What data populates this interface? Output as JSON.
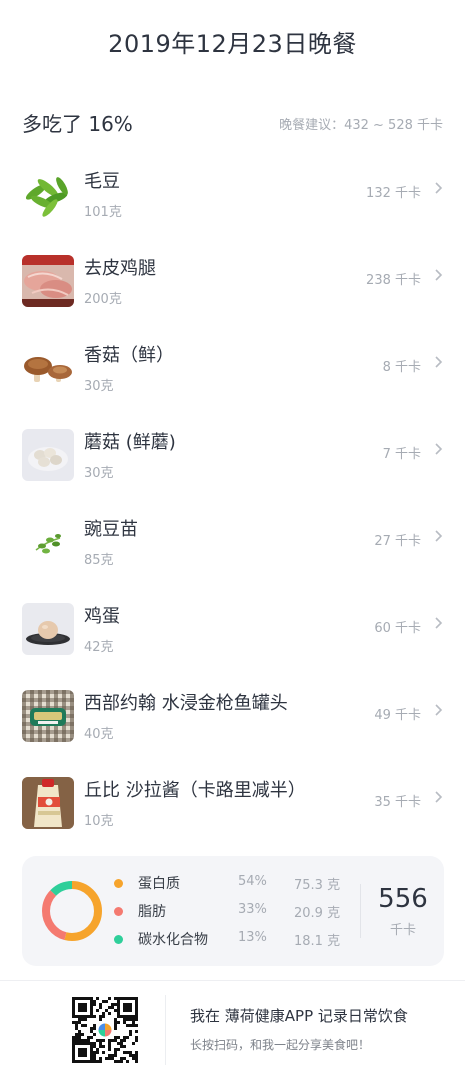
{
  "page": {
    "title": "2019年12月23日晚餐"
  },
  "summary": {
    "over_text": "多吃了 16%",
    "suggestion": "晚餐建议：432 ~ 528 千卡"
  },
  "foods": [
    {
      "name": "毛豆",
      "weight": "101克",
      "kcal": "132 千卡",
      "icon": "edamame-photo"
    },
    {
      "name": "去皮鸡腿",
      "weight": "200克",
      "kcal": "238 千卡",
      "icon": "chicken-leg-photo"
    },
    {
      "name": "香菇（鲜）",
      "weight": "30克",
      "kcal": "8 千卡",
      "icon": "shiitake-photo"
    },
    {
      "name": "蘑菇 (鲜蘑)",
      "weight": "30克",
      "kcal": "7 千卡",
      "icon": "mushroom-photo"
    },
    {
      "name": "豌豆苗",
      "weight": "85克",
      "kcal": "27 千卡",
      "icon": "pea-sprouts-photo"
    },
    {
      "name": "鸡蛋",
      "weight": "42克",
      "kcal": "60 千卡",
      "icon": "egg-photo"
    },
    {
      "name": "西部约翰 水浸金枪鱼罐头",
      "weight": "40克",
      "kcal": "49 千卡",
      "icon": "tuna-can-photo"
    },
    {
      "name": "丘比 沙拉酱（卡路里减半）",
      "weight": "10克",
      "kcal": "35 千卡",
      "icon": "salad-dressing-photo"
    }
  ],
  "nutrition": {
    "items": [
      {
        "name": "蛋白质",
        "pct": "54%",
        "grams": "75.3 克",
        "color": "#f6a42c",
        "share": 0.54
      },
      {
        "name": "脂肪",
        "pct": "33%",
        "grams": "20.9 克",
        "color": "#f47a70",
        "share": 0.33
      },
      {
        "name": "碳水化合物",
        "pct": "13%",
        "grams": "18.1 克",
        "color": "#2ecf9a",
        "share": 0.13
      }
    ],
    "total_kcal": "556",
    "unit": "千卡"
  },
  "footer": {
    "line1": "我在 薄荷健康APP 记录日常饮食",
    "line2": "长按扫码，和我一起分享美食吧！"
  },
  "colors": {
    "accent_text": "#2e3440",
    "muted_text": "#a6abb3",
    "card_bg": "#f4f5f8"
  }
}
